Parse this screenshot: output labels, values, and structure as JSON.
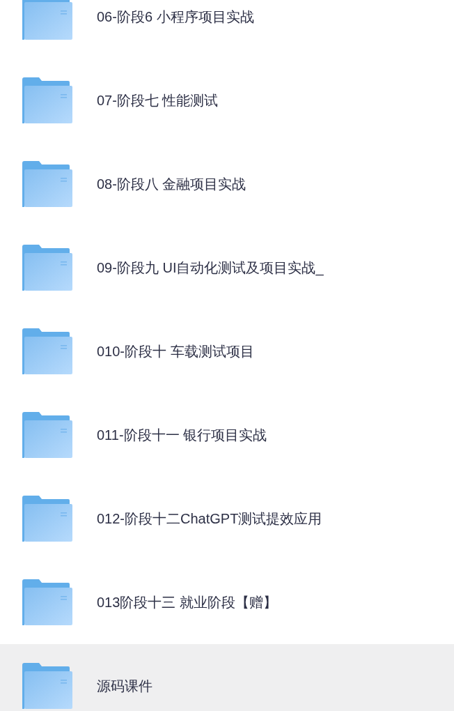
{
  "folders": [
    {
      "name": "06-阶段6 小程序项目实战",
      "selected": false
    },
    {
      "name": "07-阶段七 性能测试",
      "selected": false
    },
    {
      "name": "08-阶段八 金融项目实战",
      "selected": false
    },
    {
      "name": "09-阶段九 UI自动化测试及项目实战_",
      "selected": false
    },
    {
      "name": "010-阶段十 车载测试项目",
      "selected": false
    },
    {
      "name": "011-阶段十一 银行项目实战",
      "selected": false
    },
    {
      "name": "012-阶段十二ChatGPT测试提效应用",
      "selected": false
    },
    {
      "name": "013阶段十三 就业阶段【赠】",
      "selected": false
    },
    {
      "name": "源码课件",
      "selected": true
    }
  ]
}
